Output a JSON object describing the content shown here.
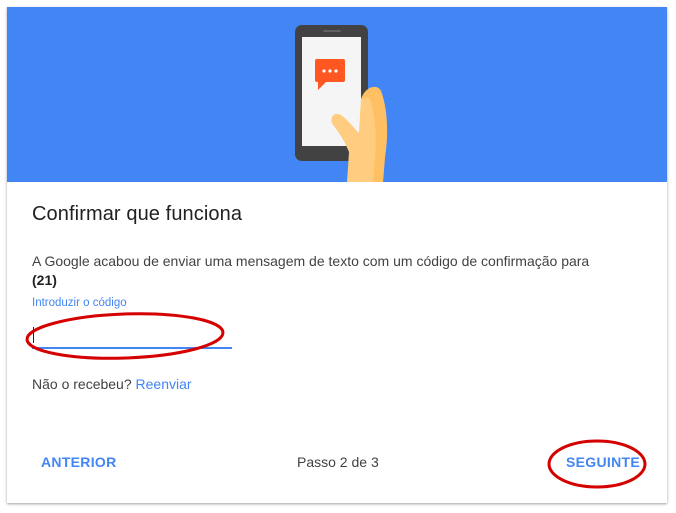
{
  "dialog": {
    "title": "Confirmar que funciona",
    "description": "A Google acabou de enviar uma mensagem de texto com um código de confirmação para",
    "phone": "(21)",
    "code_field": {
      "label": "Introduzir o código",
      "value": ""
    },
    "resend": {
      "prompt": "Não o recebeu?",
      "link": "Reenviar"
    }
  },
  "footer": {
    "back_label": "ANTERIOR",
    "step_text": "Passo 2 de 3",
    "next_label": "SEGUINTE"
  },
  "icons": {
    "hero": "phone-in-hand-icon",
    "message": "message-bubble-icon"
  },
  "colors": {
    "hero_background": "#4285f4",
    "accent": "#4285f4",
    "message_bubble": "#ff5722",
    "annotation": "#d50000"
  }
}
